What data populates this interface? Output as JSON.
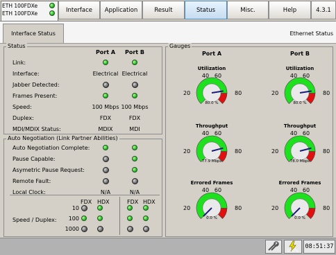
{
  "device": {
    "line1": "ETH 100FDXe",
    "line2": "ETH 100FDXe"
  },
  "tabs": [
    "Interface",
    "Application",
    "Result",
    "Status",
    "Misc.",
    "Help",
    "4.3.1"
  ],
  "active_tab": "Status",
  "subtab": "Interface Status",
  "section_title": "Ethernet Status",
  "status": {
    "title": "Status",
    "port_a": "Port A",
    "port_b": "Port B",
    "rows": [
      {
        "label": "Link:",
        "a": "",
        "b": ""
      },
      {
        "label": "Interface:",
        "a": "Electrical",
        "b": "Electrical"
      },
      {
        "label": "Jabber Detected:",
        "a": "",
        "b": ""
      },
      {
        "label": "Frames Present:",
        "a": "",
        "b": ""
      },
      {
        "label": "Speed:",
        "a": "100 Mbps",
        "b": "100 Mbps"
      },
      {
        "label": "Duplex:",
        "a": "FDX",
        "b": "FDX"
      },
      {
        "label": "MDI/MDIX Status:",
        "a": "MDIX",
        "b": "MDI"
      }
    ]
  },
  "auto_neg": {
    "title": "Auto Negotiation (Link Partner Abilities)",
    "rows": [
      {
        "label": "Auto Negotiation Complete:",
        "a": "",
        "b": ""
      },
      {
        "label": "Pause Capable:",
        "a": "",
        "b": ""
      },
      {
        "label": "Asymetric Pause Request:",
        "a": "",
        "b": ""
      },
      {
        "label": "Remote Fault:",
        "a": "",
        "b": ""
      },
      {
        "label": "Local Clock:",
        "a": "N/A",
        "b": "N/A"
      }
    ],
    "speed_duplex_label": "Speed / Duplex:",
    "fdx": "FDX",
    "hdx": "HDX",
    "speeds": [
      "10",
      "100",
      "1000"
    ]
  },
  "gauges": {
    "title": "Gauges",
    "port_a": "Port A",
    "port_b": "Port B",
    "scale": {
      "min": "20",
      "mid1": "40",
      "mid2": "60",
      "max": "80"
    },
    "rows": [
      {
        "title": "Utilization",
        "a_value": 80,
        "a_text": "80.0 %",
        "b_value": 80,
        "b_text": "80.0 %"
      },
      {
        "title": "Throughput",
        "a_value": 77.9,
        "a_text": "77.9 Mbps",
        "b_value": 78,
        "b_text": "78.0 Mbps"
      },
      {
        "title": "Errored Frames",
        "a_value": 0,
        "a_text": "0.0 %",
        "b_value": 0,
        "b_text": "0.0 %"
      }
    ]
  },
  "statusbar": {
    "time": "08:51:37",
    "battery_text": "100%"
  },
  "colors": {
    "gauge_green": "#1fe01f",
    "gauge_red": "#e01010",
    "needle": "#1b1b7a",
    "active_tab": "#c7dcef"
  }
}
